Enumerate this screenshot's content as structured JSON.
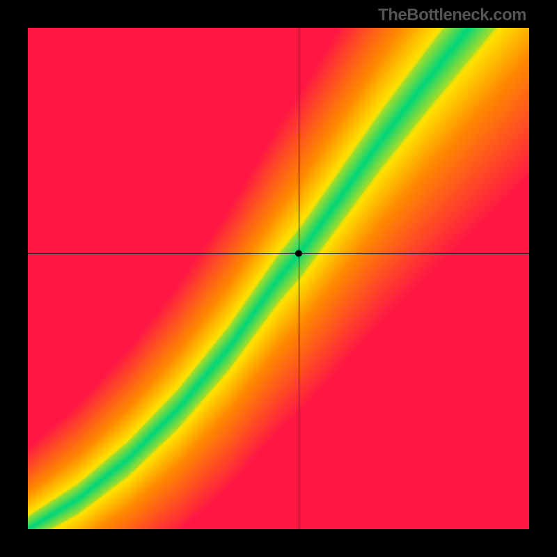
{
  "source_label": "TheBottleneck.com",
  "colors": {
    "background_frame": "#000000",
    "good": "#00d67a",
    "mid": "#ffe200",
    "warm": "#ff8a00",
    "bad": "#ff1744",
    "crosshair": "#000000",
    "marker": "#000000"
  },
  "chart_data": {
    "type": "heatmap",
    "title": "",
    "xlabel": "",
    "ylabel": "",
    "xlim": [
      0,
      100
    ],
    "ylim": [
      0,
      100
    ],
    "grid": false,
    "curve_samples": [
      {
        "x": 0,
        "y": 0
      },
      {
        "x": 10,
        "y": 6
      },
      {
        "x": 20,
        "y": 14
      },
      {
        "x": 30,
        "y": 24
      },
      {
        "x": 40,
        "y": 36
      },
      {
        "x": 50,
        "y": 50
      },
      {
        "x": 55,
        "y": 56
      },
      {
        "x": 60,
        "y": 63
      },
      {
        "x": 70,
        "y": 77
      },
      {
        "x": 80,
        "y": 90
      },
      {
        "x": 88,
        "y": 100
      }
    ],
    "band_half_width": {
      "bottom_frac": 0.025,
      "top_frac": 0.07
    },
    "crosshair": {
      "x": 54,
      "y": 55
    },
    "marker": {
      "x": 54,
      "y": 55
    },
    "notes": "Heatmap encodes distance from the optimal-balance curve; green = on-curve, red = far off. Axes are normalized 0-100 component scores."
  }
}
